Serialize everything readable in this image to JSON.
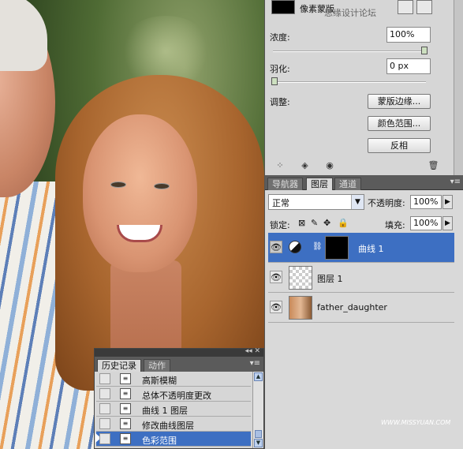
{
  "mask_panel": {
    "title": "像素蒙版",
    "density_label": "浓度:",
    "density_value": "100%",
    "feather_label": "羽化:",
    "feather_value": "0 px",
    "adjust_label": "调整:",
    "buttons": [
      "蒙版边缘...",
      "颜色范围...",
      "反相"
    ]
  },
  "watermark": "思缘设计论坛",
  "watermark_url": "WWW.MISSYUAN.COM",
  "layers_panel": {
    "tabs": [
      "导航器",
      "图层",
      "通道"
    ],
    "active_tab": "图层",
    "blend_mode": "正常",
    "opacity_label": "不透明度:",
    "opacity_value": "100%",
    "lock_label": "锁定:",
    "fill_label": "填充:",
    "fill_value": "100%",
    "layers": [
      {
        "name": "曲线 1",
        "selected": true
      },
      {
        "name": "图层 1",
        "selected": false
      },
      {
        "name": "father_daughter",
        "selected": false
      }
    ]
  },
  "history_panel": {
    "tabs": [
      "历史记录",
      "动作"
    ],
    "active_tab": "历史记录",
    "items": [
      {
        "label": "高斯模糊",
        "selected": false
      },
      {
        "label": "总体不透明度更改",
        "selected": false
      },
      {
        "label": "曲线 1 图层",
        "selected": false
      },
      {
        "label": "修改曲线图层",
        "selected": false
      },
      {
        "label": "色彩范围",
        "selected": true
      }
    ]
  }
}
